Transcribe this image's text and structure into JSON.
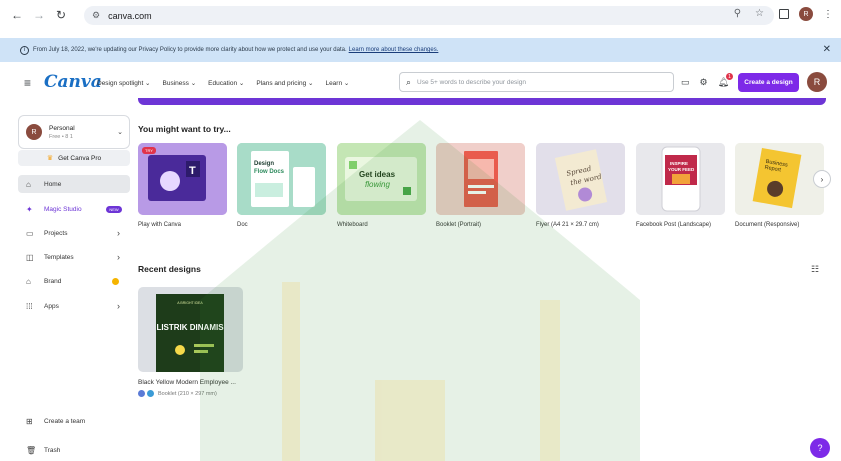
{
  "browser": {
    "url": "canva.com",
    "avatar_initial": "R"
  },
  "banner": {
    "text": "From July 18, 2022, we're updating our Privacy Policy to provide more clarity about how we protect and use your data.",
    "link": "Learn more about these changes."
  },
  "topbar": {
    "logo": "Canva",
    "menu": [
      "Design spotlight ⌄",
      "Business ⌄",
      "Education ⌄",
      "Plans and pricing ⌄",
      "Learn ⌄"
    ],
    "search_placeholder": "Use 5+ words to describe your design",
    "notification_count": "1",
    "create_button": "Create a design",
    "avatar_initial": "R"
  },
  "sidebar": {
    "account_name": "Personal",
    "account_sub": "Free • 8 1",
    "avatar_initial": "R",
    "pro_button": "Get Canva Pro",
    "items": [
      {
        "label": "Home",
        "icon": "home-icon"
      },
      {
        "label": "Magic Studio",
        "icon": "magic-icon",
        "badge": "NEW"
      },
      {
        "label": "Projects",
        "icon": "folder-icon"
      },
      {
        "label": "Templates",
        "icon": "template-icon"
      },
      {
        "label": "Brand",
        "icon": "brand-icon"
      },
      {
        "label": "Apps",
        "icon": "apps-icon"
      }
    ],
    "bottom_items": [
      {
        "label": "Create a team",
        "icon": "team-icon"
      },
      {
        "label": "Trash",
        "icon": "trash-icon"
      }
    ]
  },
  "main": {
    "try_title": "You might want to try...",
    "try_badge": "TRY",
    "cards": [
      {
        "label": "Play with Canva",
        "thumb_text": ""
      },
      {
        "label": "Doc",
        "thumb_text": "Design Flow Docs"
      },
      {
        "label": "Whiteboard",
        "thumb_text": "Get ideas flowing"
      },
      {
        "label": "Booklet (Portrait)",
        "thumb_text": ""
      },
      {
        "label": "Flyer (A4 21 × 29.7 cm)",
        "thumb_text": "Spread the word"
      },
      {
        "label": "Facebook Post (Landscape)",
        "thumb_text": "INSPIRE YOUR FEED"
      },
      {
        "label": "Document (Responsive)",
        "thumb_text": "Business Report"
      }
    ],
    "recent_title": "Recent designs",
    "recent": {
      "thumb_title": "LISTRIK DINAMIS",
      "thumb_sub": "A BRIGHT IDEA",
      "name": "Black Yellow Modern Employee ...",
      "meta": "Booklet (210 × 297 mm)"
    }
  },
  "help_label": "?"
}
